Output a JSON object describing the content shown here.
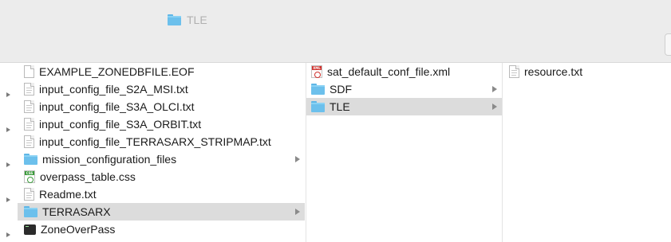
{
  "window": {
    "title": "TLE"
  },
  "columns": [
    {
      "items": [
        {
          "name": "EXAMPLE_ZONEDBFILE.EOF",
          "icon": "blank-document-icon",
          "selected": false,
          "has_disclosure": false,
          "has_chevron": false
        },
        {
          "name": "input_config_file_S2A_MSI.txt",
          "icon": "text-document-icon",
          "selected": false,
          "has_disclosure": true,
          "has_chevron": false
        },
        {
          "name": "input_config_file_S3A_OLCI.txt",
          "icon": "text-document-icon",
          "selected": false,
          "has_disclosure": false,
          "has_chevron": false
        },
        {
          "name": "input_config_file_S3A_ORBIT.txt",
          "icon": "text-document-icon",
          "selected": false,
          "has_disclosure": true,
          "has_chevron": false
        },
        {
          "name": "input_config_file_TERRASARX_STRIPMAP.txt",
          "icon": "text-document-icon",
          "selected": false,
          "has_disclosure": false,
          "has_chevron": false
        },
        {
          "name": "mission_configuration_files",
          "icon": "folder-icon",
          "selected": false,
          "has_disclosure": true,
          "has_chevron": true
        },
        {
          "name": "overpass_table.css",
          "icon": "css-file-icon",
          "selected": false,
          "has_disclosure": false,
          "has_chevron": false
        },
        {
          "name": "Readme.txt",
          "icon": "text-document-icon",
          "selected": false,
          "has_disclosure": true,
          "has_chevron": false
        },
        {
          "name": "TERRASARX",
          "icon": "folder-icon",
          "selected": true,
          "has_disclosure": false,
          "has_chevron": true
        },
        {
          "name": "ZoneOverPass",
          "icon": "terminal-executable-icon",
          "selected": false,
          "has_disclosure": true,
          "has_chevron": false
        }
      ]
    },
    {
      "items": [
        {
          "name": "sat_default_conf_file.xml",
          "icon": "xml-file-icon",
          "selected": false,
          "has_chevron": false
        },
        {
          "name": "SDF",
          "icon": "folder-icon",
          "selected": false,
          "has_chevron": true
        },
        {
          "name": "TLE",
          "icon": "folder-icon",
          "selected": true,
          "has_chevron": true
        }
      ]
    },
    {
      "items": [
        {
          "name": "resource.txt",
          "icon": "text-document-icon",
          "selected": false,
          "has_chevron": false
        }
      ]
    }
  ],
  "colors": {
    "folder": "#6cc0ec",
    "selection": "#dcdcdc",
    "titlebar": "#ececec",
    "css_badge": "#3c9a3c",
    "xml_badge": "#d0312d"
  }
}
